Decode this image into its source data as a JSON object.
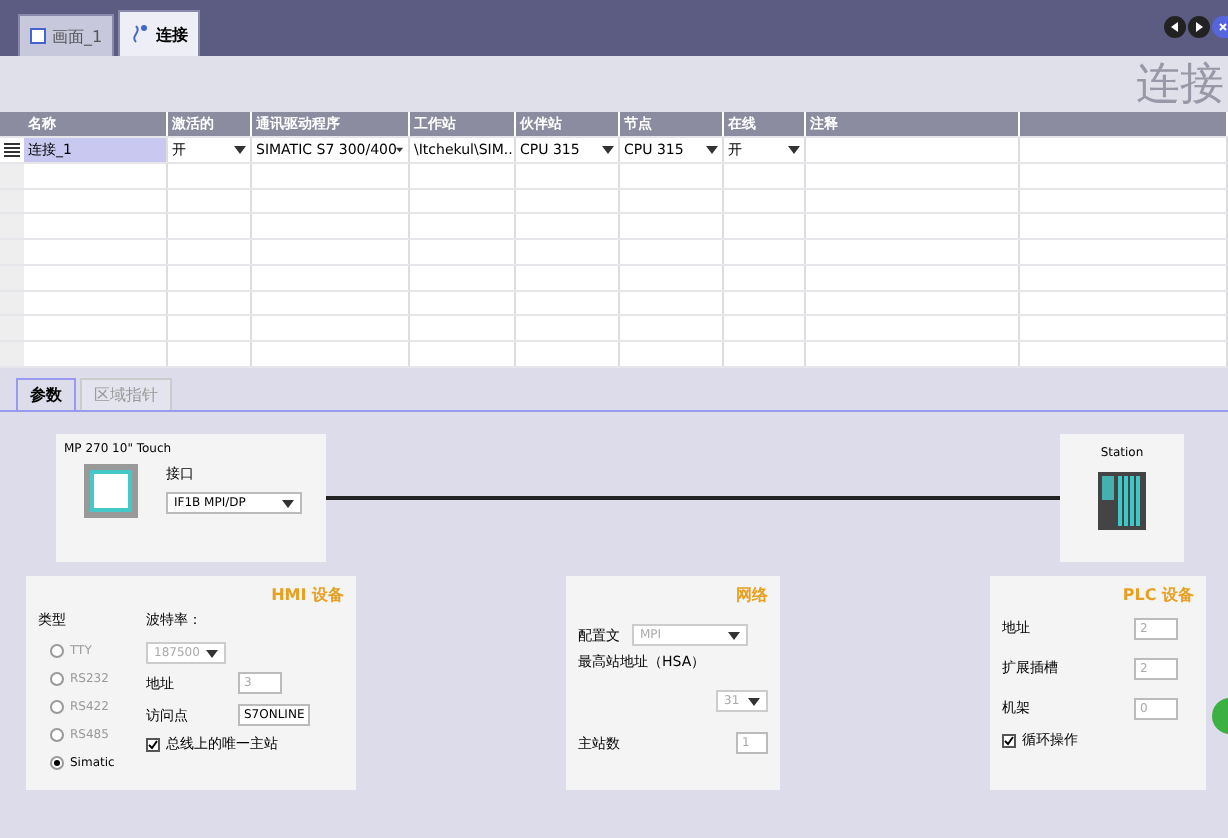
{
  "editor_tabs": [
    {
      "label": "画面_1",
      "kind": "screen",
      "selected": false
    },
    {
      "label": "连接",
      "kind": "connection",
      "selected": true
    }
  ],
  "editor_title": "连接",
  "table": {
    "columns": [
      "名称",
      "激活的",
      "通讯驱动程序",
      "工作站",
      "伙伴站",
      "节点",
      "在线",
      "注释"
    ],
    "rows": [
      {
        "cells": [
          {
            "text": "连接_1",
            "kind": "text"
          },
          {
            "text": "开",
            "kind": "dropdown"
          },
          {
            "text": "SIMATIC S7 300/400",
            "kind": "dropdown"
          },
          {
            "text": "\\Itchekul\\SIM...",
            "kind": "dropdown"
          },
          {
            "text": "CPU 315",
            "kind": "dropdown"
          },
          {
            "text": "CPU 315",
            "kind": "dropdown"
          },
          {
            "text": "开",
            "kind": "dropdown"
          },
          {
            "text": "",
            "kind": "text"
          }
        ],
        "selected": true
      }
    ]
  },
  "param_tabs": [
    {
      "label": "参数",
      "selected": true
    },
    {
      "label": "区域指针",
      "selected": false
    }
  ],
  "hmi_node": {
    "name": "MP 270 10\" Touch",
    "interface_label": "接口",
    "interface": "IF1B MPI/DP"
  },
  "plc_node": {
    "name": "Station"
  },
  "hmi_device": {
    "title": "HMI 设备",
    "type_label": "类型",
    "types": [
      {
        "label": "TTY",
        "selected": false
      },
      {
        "label": "RS232",
        "selected": false
      },
      {
        "label": "RS422",
        "selected": false
      },
      {
        "label": "RS485",
        "selected": false
      },
      {
        "label": "Simatic",
        "selected": true
      }
    ],
    "baud_label": "波特率：",
    "baud": "187500",
    "address_label": "地址",
    "address": "3",
    "access_label": "访问点",
    "access": "S7ONLINE",
    "single_master": {
      "label": "总线上的唯一主站",
      "checked": true
    }
  },
  "network": {
    "title": "网络",
    "profile_label": "配置文",
    "profile": "MPI",
    "hsa_label": "最高站地址（HSA）",
    "hsa": "31",
    "masters_label": "主站数",
    "masters": "1"
  },
  "plc_device": {
    "title": "PLC 设备",
    "fields": [
      {
        "label": "地址",
        "value": "2"
      },
      {
        "label": "扩展插槽",
        "value": "2"
      },
      {
        "label": "机架",
        "value": "0"
      }
    ],
    "cyclic": {
      "label": "循环操作",
      "checked": true
    }
  }
}
